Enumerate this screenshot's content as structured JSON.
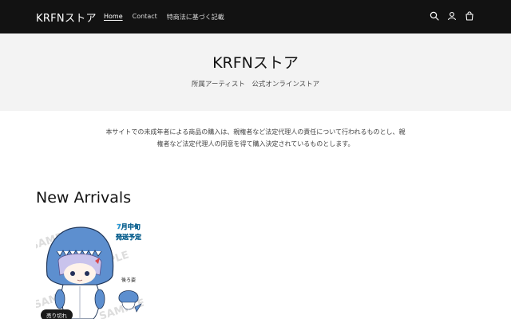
{
  "header": {
    "logo": "KRFNストア",
    "nav": [
      {
        "label": "Home"
      },
      {
        "label": "Contact"
      },
      {
        "label": "特商法に基づく記載"
      }
    ],
    "icons": [
      "search-icon",
      "user-icon",
      "cart-icon"
    ]
  },
  "banner": {
    "title": "KRFNストア",
    "subtitle": "所属アーティスト　公式オンラインストア"
  },
  "notice": {
    "line1": "本サイトでの未成年者による商品の購入は、親権者など法定代理人の責任について行われるものとし、親",
    "line2": "権者など法定代理人の同意を得て購入決定されているものとします。"
  },
  "new_arrivals": {
    "title": "New Arrivals",
    "products": [
      {
        "image_text": {
          "line1": "7月中旬",
          "line2": "発送予定",
          "back": "後ろ姿",
          "watermark": "SAMPLE"
        },
        "badge": "売り切れ"
      }
    ]
  },
  "colors": {
    "header_bg": "#121212",
    "banner_bg": "#f3f3f3",
    "accent_blue": "#4f83c2"
  }
}
